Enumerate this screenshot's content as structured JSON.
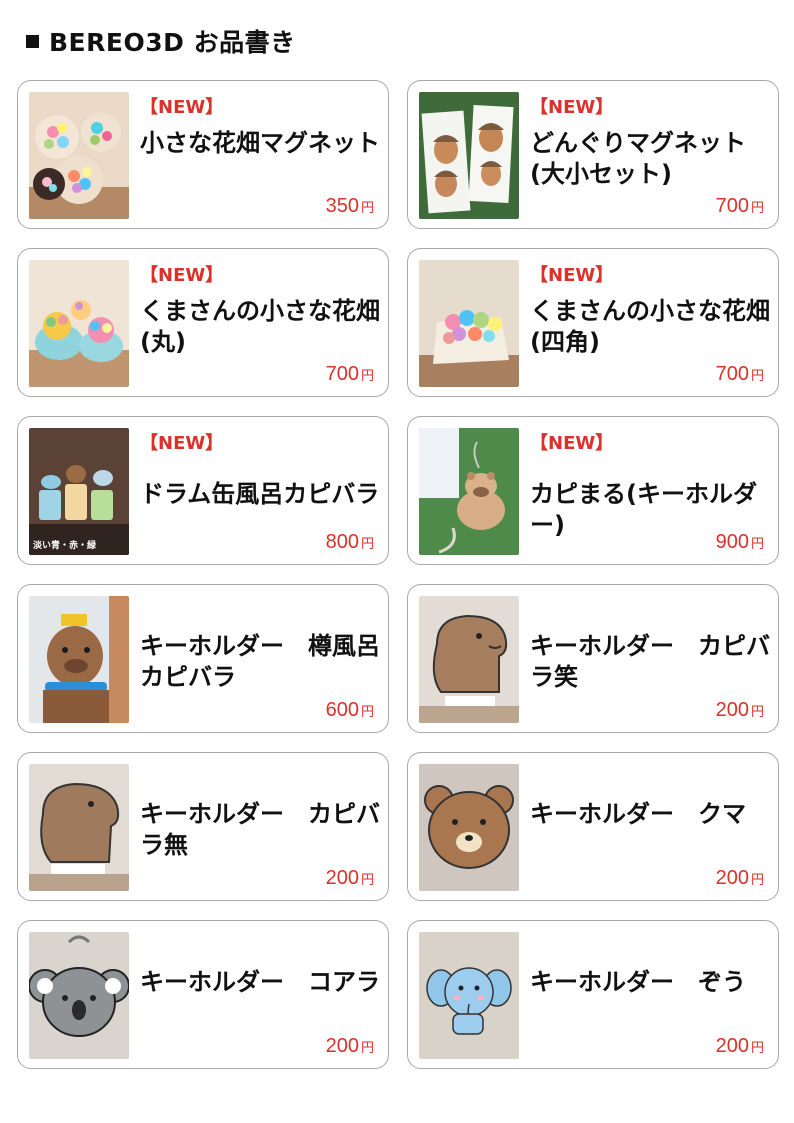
{
  "header": {
    "title": "BEREO3D お品書き"
  },
  "products": [
    {
      "new": "【NEW】",
      "name": "小さな花畑マグネット",
      "price": "350",
      "yen": "円",
      "icon": "flower-magnets"
    },
    {
      "new": "【NEW】",
      "name": "どんぐりマグネット(大小セット)",
      "price": "700",
      "yen": "円",
      "icon": "acorn-magnets"
    },
    {
      "new": "【NEW】",
      "name": "くまさんの小さな花畑(丸)",
      "price": "700",
      "yen": "円",
      "icon": "bear-flower-round"
    },
    {
      "new": "【NEW】",
      "name": "くまさんの小さな花畑(四角)",
      "price": "700",
      "yen": "円",
      "icon": "bear-flower-square"
    },
    {
      "new": "【NEW】",
      "name": "ドラム缶風呂カピバラ",
      "price": "800",
      "yen": "円",
      "icon": "drum-bath-capybara",
      "photo_caption": "淡い青・赤・緑"
    },
    {
      "new": "【NEW】",
      "name": "カピまる(キーホルダー)",
      "price": "900",
      "yen": "円",
      "icon": "capimaru-keychain"
    },
    {
      "new": "",
      "name": "キーホルダー　樽風呂カピバラ",
      "price": "600",
      "yen": "円",
      "icon": "barrel-bath-capybara"
    },
    {
      "new": "",
      "name": "キーホルダー　カピバラ笑",
      "price": "200",
      "yen": "円",
      "icon": "capybara-smile"
    },
    {
      "new": "",
      "name": "キーホルダー　カピバラ無",
      "price": "200",
      "yen": "円",
      "icon": "capybara-plain"
    },
    {
      "new": "",
      "name": "キーホルダー　クマ",
      "price": "200",
      "yen": "円",
      "icon": "bear-keychain"
    },
    {
      "new": "",
      "name": "キーホルダー　コアラ",
      "price": "200",
      "yen": "円",
      "icon": "koala-keychain"
    },
    {
      "new": "",
      "name": "キーホルダー　ぞう",
      "price": "200",
      "yen": "円",
      "icon": "elephant-keychain"
    }
  ]
}
